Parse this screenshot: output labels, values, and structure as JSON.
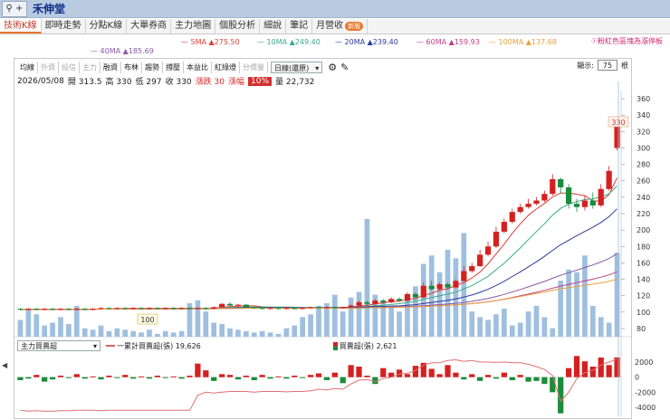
{
  "window": {
    "search_label": "⚲ +",
    "title": "禾伸堂"
  },
  "tabs": [
    {
      "label": "技術K線",
      "active": true,
      "badge": ""
    },
    {
      "label": "即時走勢",
      "active": false,
      "badge": ""
    },
    {
      "label": "分點K線",
      "active": false,
      "badge": ""
    },
    {
      "label": "大單券商",
      "active": false,
      "badge": ""
    },
    {
      "label": "主力地圖",
      "active": false,
      "badge": ""
    },
    {
      "label": "個股分析",
      "active": false,
      "badge": ""
    },
    {
      "label": "細說",
      "active": false,
      "badge": ""
    },
    {
      "label": "筆記",
      "active": false,
      "badge": ""
    },
    {
      "label": "月營收",
      "active": false,
      "badge": "新版"
    }
  ],
  "ma_legend": {
    "ma5": "5MA ▲275.50",
    "ma10": "10MA ▲249.40",
    "ma20": "20MA ▲239.40",
    "ma60": "60MA ▲159.93",
    "ma100": "100MA ▲137.68",
    "ma40": "40MA ▲185.69",
    "colors": {
      "ma5": "#d9403a",
      "ma10": "#3aaa8a",
      "ma20": "#2b3b9a",
      "ma60": "#c23f86",
      "ma100": "#e8a23a",
      "ma40": "#8a5aa8"
    }
  },
  "fav_label": "☉粉紅色區塊為漲停板",
  "toolbar": [
    "均線",
    "外資",
    "投信",
    "主力",
    "融資",
    "布林",
    "趨勢",
    "撐壓",
    "本益比",
    "紅綠燈",
    "分價量"
  ],
  "toolbar_off": [
    1,
    2,
    3,
    10
  ],
  "period_select": "日線(還原)",
  "display": {
    "label": "顯示:",
    "value": "75",
    "unit": "根"
  },
  "info": {
    "date": "2026/05/08",
    "open": "開 313.5",
    "high": "高 330",
    "low": "低 297",
    "close": "收 330",
    "change": "漲跌 30",
    "pct_label": "漲幅",
    "pct": "10%",
    "volume": "量 22,732"
  },
  "sub_panel": {
    "select": "主力買賣超",
    "cum_label": "一累計買賣超(張) 19,626",
    "daily_label": "買賣超(張) 2,621"
  },
  "colors": {
    "up": "#d62020",
    "down": "#1a8c3a",
    "volume": "#9fbfdf",
    "accent": "#e8762b"
  },
  "chart_data": {
    "type": "candlestick",
    "price_axis_ticks": [
      80,
      100,
      120,
      140,
      160,
      180,
      200,
      220,
      240,
      260,
      280,
      300,
      320,
      340,
      360
    ],
    "price_ylim": [
      70,
      370
    ],
    "sub_axis_ticks": [
      2000,
      0,
      -2000,
      -4000
    ],
    "sub_ylim": [
      -5200,
      3200
    ],
    "low_marker": "100",
    "high_marker": "330",
    "candles": [
      [
        104,
        103,
        105,
        102
      ],
      [
        103,
        104,
        105,
        102
      ],
      [
        104,
        103,
        105,
        102
      ],
      [
        103,
        104,
        105,
        102
      ],
      [
        104,
        103,
        105,
        102
      ],
      [
        103,
        104,
        105,
        102
      ],
      [
        104,
        103,
        105,
        102
      ],
      [
        103,
        104,
        105,
        102
      ],
      [
        104,
        103,
        105,
        102
      ],
      [
        103,
        104,
        105,
        102
      ],
      [
        104,
        105,
        106,
        103
      ],
      [
        105,
        104,
        106,
        103
      ],
      [
        104,
        105,
        106,
        103
      ],
      [
        105,
        104,
        106,
        103
      ],
      [
        104,
        105,
        106,
        103
      ],
      [
        105,
        104,
        106,
        103
      ],
      [
        104,
        105,
        106,
        103
      ],
      [
        105,
        104,
        106,
        103
      ],
      [
        104,
        105,
        106,
        103
      ],
      [
        105,
        104,
        106,
        103
      ],
      [
        104,
        105,
        106,
        103
      ],
      [
        105,
        104,
        106,
        103
      ],
      [
        104,
        105,
        106,
        103
      ],
      [
        105,
        104,
        106,
        103
      ],
      [
        104,
        106,
        107,
        103
      ],
      [
        106,
        110,
        111,
        105
      ],
      [
        110,
        108,
        112,
        107
      ],
      [
        108,
        109,
        110,
        106
      ],
      [
        109,
        106,
        110,
        105
      ],
      [
        106,
        105,
        107,
        104
      ],
      [
        105,
        104,
        106,
        103
      ],
      [
        104,
        105,
        106,
        103
      ],
      [
        105,
        104,
        106,
        103
      ],
      [
        104,
        105,
        106,
        103
      ],
      [
        105,
        104,
        106,
        103
      ],
      [
        104,
        105,
        106,
        103
      ],
      [
        105,
        106,
        107,
        104
      ],
      [
        106,
        105,
        107,
        104
      ],
      [
        105,
        106,
        107,
        104
      ],
      [
        106,
        105,
        107,
        104
      ],
      [
        105,
        106,
        107,
        104
      ],
      [
        106,
        108,
        109,
        105
      ],
      [
        108,
        112,
        114,
        107
      ],
      [
        112,
        110,
        114,
        108
      ],
      [
        110,
        114,
        116,
        109
      ],
      [
        114,
        112,
        116,
        110
      ],
      [
        112,
        116,
        118,
        111
      ],
      [
        116,
        114,
        118,
        112
      ],
      [
        114,
        122,
        124,
        113
      ],
      [
        122,
        118,
        124,
        116
      ],
      [
        118,
        132,
        136,
        117
      ],
      [
        132,
        128,
        138,
        126
      ],
      [
        128,
        134,
        136,
        126
      ],
      [
        134,
        130,
        136,
        128
      ],
      [
        130,
        138,
        140,
        129
      ],
      [
        138,
        150,
        156,
        137
      ],
      [
        150,
        156,
        160,
        148
      ],
      [
        156,
        170,
        176,
        155
      ],
      [
        170,
        180,
        186,
        168
      ],
      [
        180,
        198,
        204,
        178
      ],
      [
        198,
        210,
        214,
        196
      ],
      [
        210,
        222,
        226,
        208
      ],
      [
        222,
        228,
        232,
        220
      ],
      [
        228,
        232,
        238,
        226
      ],
      [
        232,
        236,
        240,
        230
      ],
      [
        236,
        244,
        248,
        234
      ],
      [
        244,
        262,
        268,
        242
      ],
      [
        262,
        252,
        264,
        244
      ],
      [
        252,
        232,
        256,
        226
      ],
      [
        232,
        228,
        238,
        222
      ],
      [
        228,
        236,
        242,
        224
      ],
      [
        236,
        230,
        246,
        226
      ],
      [
        230,
        250,
        256,
        228
      ],
      [
        250,
        272,
        278,
        248
      ],
      [
        300,
        330,
        332,
        297
      ]
    ],
    "volume": [
      12,
      20,
      16,
      8,
      10,
      14,
      9,
      22,
      6,
      5,
      8,
      4,
      6,
      5,
      4,
      3,
      5,
      2,
      4,
      3,
      4,
      24,
      26,
      18,
      10,
      9,
      6,
      5,
      4,
      3,
      4,
      3,
      2,
      6,
      8,
      14,
      16,
      22,
      24,
      30,
      18,
      28,
      32,
      84,
      30,
      26,
      22,
      18,
      28,
      36,
      52,
      58,
      46,
      62,
      56,
      74,
      18,
      14,
      12,
      16,
      20,
      8,
      10,
      18,
      22,
      14,
      6,
      40,
      48,
      46,
      58,
      22,
      14,
      10,
      60
    ],
    "net_buy": [
      -400,
      -200,
      300,
      -600,
      -300,
      200,
      -100,
      400,
      -200,
      100,
      -300,
      200,
      -100,
      300,
      -200,
      100,
      -200,
      200,
      -100,
      100,
      -200,
      200,
      1800,
      900,
      -500,
      400,
      300,
      -300,
      200,
      -400,
      300,
      -200,
      100,
      -200,
      200,
      -100,
      300,
      500,
      -400,
      600,
      -800,
      1600,
      1400,
      200,
      -900,
      1200,
      600,
      1000,
      400,
      1500,
      1900,
      1100,
      400,
      1600,
      600,
      -300,
      400,
      -500,
      300,
      -200,
      600,
      -400,
      300,
      -600,
      -500,
      -900,
      -2000,
      -4800,
      1200,
      2800,
      2100,
      1400,
      2600,
      1600,
      2621
    ],
    "cumulative_scaled": [
      -4400,
      -4500,
      -4450,
      -4500,
      -4500,
      -4450,
      -4450,
      -4400,
      -4400,
      -4400,
      -4450,
      -4400,
      -4400,
      -4400,
      -4400,
      -4400,
      -4400,
      -4400,
      -4400,
      -4400,
      -4400,
      -4400,
      -2400,
      -2000,
      -2100,
      -2000,
      -1900,
      -1900,
      -1900,
      -2000,
      -1900,
      -1900,
      -1900,
      -1950,
      -1900,
      -1900,
      -1800,
      -1600,
      -1700,
      -1500,
      -1600,
      -900,
      -400,
      -300,
      -600,
      -200,
      0,
      400,
      500,
      900,
      1600,
      1900,
      1900,
      2200,
      2300,
      2100,
      2200,
      2000,
      2000,
      1950,
      2000,
      1900,
      1900,
      1700,
      1400,
      1000,
      200,
      -3200,
      -2000,
      -200,
      600,
      900,
      1600,
      2000,
      2400
    ]
  }
}
